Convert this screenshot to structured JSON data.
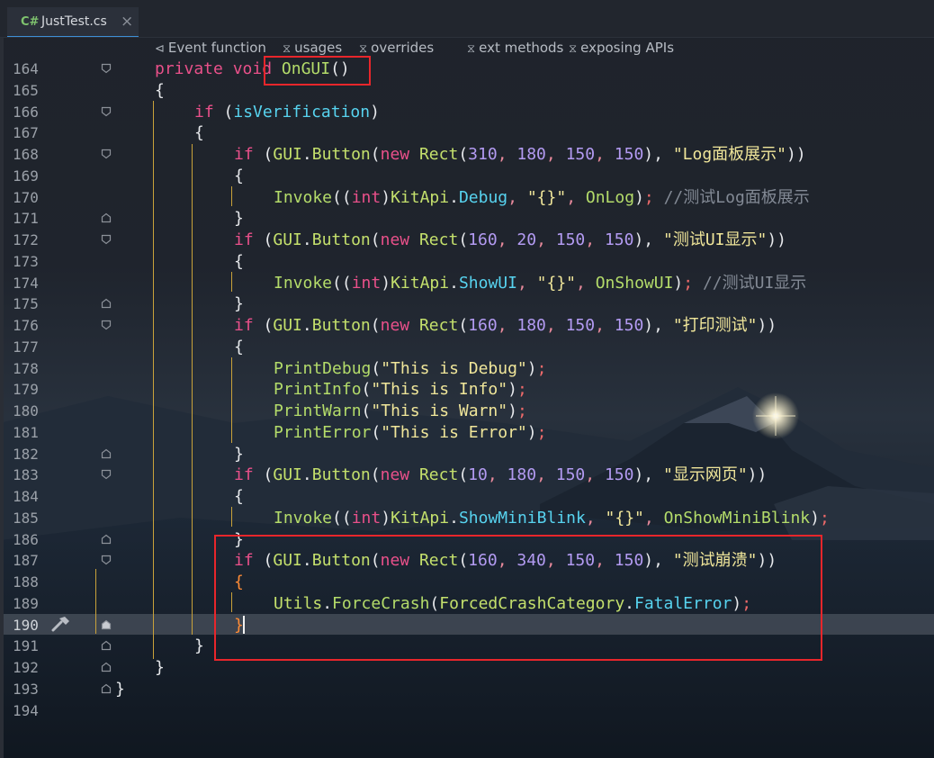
{
  "tab": {
    "lang": "C#",
    "filename": "JustTest.cs",
    "close": "×"
  },
  "hints": [
    {
      "icon": "event-icon",
      "glyph": "⊲",
      "label": "Event function"
    },
    {
      "icon": "hourglass-icon",
      "glyph": "⧖",
      "label": "usages"
    },
    {
      "icon": "hourglass-icon",
      "glyph": "⧖",
      "label": "overrides"
    },
    {
      "icon": "hourglass-icon",
      "glyph": "⧖",
      "label": "ext methods"
    },
    {
      "icon": "hourglass-icon",
      "glyph": "⧖",
      "label": "exposing APIs"
    }
  ],
  "editor": {
    "active_line": "190",
    "line_numbers": [
      "164",
      "165",
      "166",
      "167",
      "168",
      "169",
      "170",
      "171",
      "172",
      "173",
      "174",
      "175",
      "176",
      "177",
      "178",
      "179",
      "180",
      "181",
      "182",
      "183",
      "184",
      "185",
      "186",
      "187",
      "188",
      "189",
      "190",
      "191",
      "192",
      "193",
      "194"
    ],
    "lines": [
      [
        [
          "kw",
          "private"
        ],
        [
          "plain",
          " "
        ],
        [
          "kw",
          "void"
        ],
        [
          "plain",
          " "
        ],
        [
          "fn",
          "OnGUI"
        ],
        [
          "punc",
          "()"
        ]
      ],
      [
        [
          "punc",
          "{"
        ]
      ],
      [
        [
          "kw",
          "if"
        ],
        [
          "plain",
          " ("
        ],
        [
          "prop",
          "isVerification"
        ],
        [
          "plain",
          ")"
        ]
      ],
      [
        [
          "punc",
          "{"
        ]
      ],
      [
        [
          "kw",
          "if"
        ],
        [
          "plain",
          " ("
        ],
        [
          "type",
          "GUI"
        ],
        [
          "dot",
          "."
        ],
        [
          "type",
          "Button"
        ],
        [
          "plain",
          "("
        ],
        [
          "kw",
          "new"
        ],
        [
          "plain",
          " "
        ],
        [
          "type",
          "Rect"
        ],
        [
          "plain",
          "("
        ],
        [
          "num",
          "310"
        ],
        [
          "comma",
          ", "
        ],
        [
          "num",
          "180"
        ],
        [
          "comma",
          ", "
        ],
        [
          "num",
          "150"
        ],
        [
          "comma",
          ", "
        ],
        [
          "num",
          "150"
        ],
        [
          "plain",
          "), "
        ],
        [
          "str",
          "\"Log面板展示\""
        ],
        [
          "plain",
          "))"
        ]
      ],
      [
        [
          "punc",
          "{"
        ]
      ],
      [
        [
          "fn",
          "Invoke"
        ],
        [
          "plain",
          "(("
        ],
        [
          "kw",
          "int"
        ],
        [
          "plain",
          ")"
        ],
        [
          "type",
          "KitApi"
        ],
        [
          "dot",
          "."
        ],
        [
          "prop",
          "Debug"
        ],
        [
          "comma",
          ", "
        ],
        [
          "str",
          "\"{}\""
        ],
        [
          "comma",
          ", "
        ],
        [
          "fn",
          "OnLog"
        ],
        [
          "plain",
          ")"
        ],
        [
          "semi",
          ";"
        ],
        [
          "plain",
          " "
        ],
        [
          "comment",
          "//测试Log面板展示"
        ]
      ],
      [
        [
          "punc",
          "}"
        ]
      ],
      [
        [
          "kw",
          "if"
        ],
        [
          "plain",
          " ("
        ],
        [
          "type",
          "GUI"
        ],
        [
          "dot",
          "."
        ],
        [
          "type",
          "Button"
        ],
        [
          "plain",
          "("
        ],
        [
          "kw",
          "new"
        ],
        [
          "plain",
          " "
        ],
        [
          "type",
          "Rect"
        ],
        [
          "plain",
          "("
        ],
        [
          "num",
          "160"
        ],
        [
          "comma",
          ", "
        ],
        [
          "num",
          "20"
        ],
        [
          "comma",
          ", "
        ],
        [
          "num",
          "150"
        ],
        [
          "comma",
          ", "
        ],
        [
          "num",
          "150"
        ],
        [
          "plain",
          "), "
        ],
        [
          "str",
          "\"测试UI显示\""
        ],
        [
          "plain",
          "))"
        ]
      ],
      [
        [
          "punc",
          "{"
        ]
      ],
      [
        [
          "fn",
          "Invoke"
        ],
        [
          "plain",
          "(("
        ],
        [
          "kw",
          "int"
        ],
        [
          "plain",
          ")"
        ],
        [
          "type",
          "KitApi"
        ],
        [
          "dot",
          "."
        ],
        [
          "prop",
          "ShowUI"
        ],
        [
          "comma",
          ", "
        ],
        [
          "str",
          "\"{}\""
        ],
        [
          "comma",
          ", "
        ],
        [
          "fn",
          "OnShowUI"
        ],
        [
          "plain",
          ")"
        ],
        [
          "semi",
          ";"
        ],
        [
          "plain",
          " "
        ],
        [
          "comment",
          "//测试UI显示"
        ]
      ],
      [
        [
          "punc",
          "}"
        ]
      ],
      [
        [
          "kw",
          "if"
        ],
        [
          "plain",
          " ("
        ],
        [
          "type",
          "GUI"
        ],
        [
          "dot",
          "."
        ],
        [
          "type",
          "Button"
        ],
        [
          "plain",
          "("
        ],
        [
          "kw",
          "new"
        ],
        [
          "plain",
          " "
        ],
        [
          "type",
          "Rect"
        ],
        [
          "plain",
          "("
        ],
        [
          "num",
          "160"
        ],
        [
          "comma",
          ", "
        ],
        [
          "num",
          "180"
        ],
        [
          "comma",
          ", "
        ],
        [
          "num",
          "150"
        ],
        [
          "comma",
          ", "
        ],
        [
          "num",
          "150"
        ],
        [
          "plain",
          "), "
        ],
        [
          "str",
          "\"打印测试\""
        ],
        [
          "plain",
          "))"
        ]
      ],
      [
        [
          "punc",
          "{"
        ]
      ],
      [
        [
          "fn",
          "PrintDebug"
        ],
        [
          "plain",
          "("
        ],
        [
          "str",
          "\"This is Debug\""
        ],
        [
          "plain",
          ")"
        ],
        [
          "semi",
          ";"
        ]
      ],
      [
        [
          "fn",
          "PrintInfo"
        ],
        [
          "plain",
          "("
        ],
        [
          "str",
          "\"This is Info\""
        ],
        [
          "plain",
          ")"
        ],
        [
          "semi",
          ";"
        ]
      ],
      [
        [
          "fn",
          "PrintWarn"
        ],
        [
          "plain",
          "("
        ],
        [
          "str",
          "\"This is Warn\""
        ],
        [
          "plain",
          ")"
        ],
        [
          "semi",
          ";"
        ]
      ],
      [
        [
          "fn",
          "PrintError"
        ],
        [
          "plain",
          "("
        ],
        [
          "str",
          "\"This is Error\""
        ],
        [
          "plain",
          ")"
        ],
        [
          "semi",
          ";"
        ]
      ],
      [
        [
          "punc",
          "}"
        ]
      ],
      [
        [
          "kw",
          "if"
        ],
        [
          "plain",
          " ("
        ],
        [
          "type",
          "GUI"
        ],
        [
          "dot",
          "."
        ],
        [
          "type",
          "Button"
        ],
        [
          "plain",
          "("
        ],
        [
          "kw",
          "new"
        ],
        [
          "plain",
          " "
        ],
        [
          "type",
          "Rect"
        ],
        [
          "plain",
          "("
        ],
        [
          "num",
          "10"
        ],
        [
          "comma",
          ", "
        ],
        [
          "num",
          "180"
        ],
        [
          "comma",
          ", "
        ],
        [
          "num",
          "150"
        ],
        [
          "comma",
          ", "
        ],
        [
          "num",
          "150"
        ],
        [
          "plain",
          "), "
        ],
        [
          "str",
          "\"显示网页\""
        ],
        [
          "plain",
          "))"
        ]
      ],
      [
        [
          "punc",
          "{"
        ]
      ],
      [
        [
          "fn",
          "Invoke"
        ],
        [
          "plain",
          "(("
        ],
        [
          "kw",
          "int"
        ],
        [
          "plain",
          ")"
        ],
        [
          "type",
          "KitApi"
        ],
        [
          "dot",
          "."
        ],
        [
          "prop",
          "ShowMiniBlink"
        ],
        [
          "comma",
          ", "
        ],
        [
          "str",
          "\"{}\""
        ],
        [
          "comma",
          ", "
        ],
        [
          "fn",
          "OnShowMiniBlink"
        ],
        [
          "plain",
          ")"
        ],
        [
          "semi",
          ";"
        ]
      ],
      [
        [
          "punc",
          "}"
        ]
      ],
      [
        [
          "kw",
          "if"
        ],
        [
          "plain",
          " ("
        ],
        [
          "type",
          "GUI"
        ],
        [
          "dot",
          "."
        ],
        [
          "type",
          "Button"
        ],
        [
          "plain",
          "("
        ],
        [
          "kw",
          "new"
        ],
        [
          "plain",
          " "
        ],
        [
          "type",
          "Rect"
        ],
        [
          "plain",
          "("
        ],
        [
          "num",
          "160"
        ],
        [
          "comma",
          ", "
        ],
        [
          "num",
          "340"
        ],
        [
          "comma",
          ", "
        ],
        [
          "num",
          "150"
        ],
        [
          "comma",
          ", "
        ],
        [
          "num",
          "150"
        ],
        [
          "plain",
          "), "
        ],
        [
          "str",
          "\"测试崩溃\""
        ],
        [
          "plain",
          "))"
        ]
      ],
      [
        [
          "bracehl",
          "{"
        ]
      ],
      [
        [
          "type",
          "Utils"
        ],
        [
          "dot",
          "."
        ],
        [
          "fn",
          "ForceCrash"
        ],
        [
          "plain",
          "("
        ],
        [
          "type",
          "ForcedCrashCategory"
        ],
        [
          "dot",
          "."
        ],
        [
          "prop",
          "FatalError"
        ],
        [
          "plain",
          ")"
        ],
        [
          "semi",
          ";"
        ]
      ],
      [
        [
          "bracehl",
          "}"
        ]
      ],
      [
        [
          "punc",
          "}"
        ]
      ],
      [
        [
          "punc",
          "}"
        ]
      ],
      [
        [
          "punc",
          "}"
        ]
      ],
      []
    ]
  },
  "colors": {
    "keyword": "#e9508a",
    "type": "#c4e06c",
    "string": "#f0e69a",
    "number": "#b39bf2",
    "property": "#57d3ef",
    "comment": "#838a95",
    "annotation": "#e8262b"
  }
}
